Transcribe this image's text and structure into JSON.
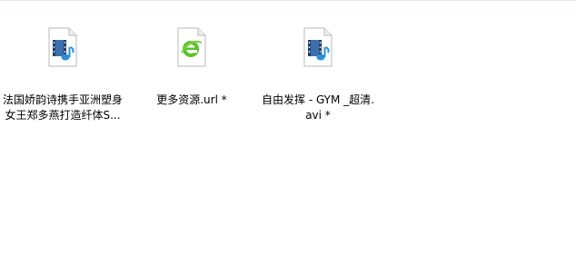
{
  "files": [
    {
      "name_line1": "法国娇韵诗携手亚洲塑身",
      "name_line2": "女王郑多燕打造纤体S...",
      "icon": "video-file-icon"
    },
    {
      "name_line1": "更多资源.url *",
      "name_line2": "",
      "icon": "ie-url-file-icon"
    },
    {
      "name_line1": "自由发挥  - GYM _超清.",
      "name_line2": "avi *",
      "icon": "video-file-icon"
    }
  ]
}
